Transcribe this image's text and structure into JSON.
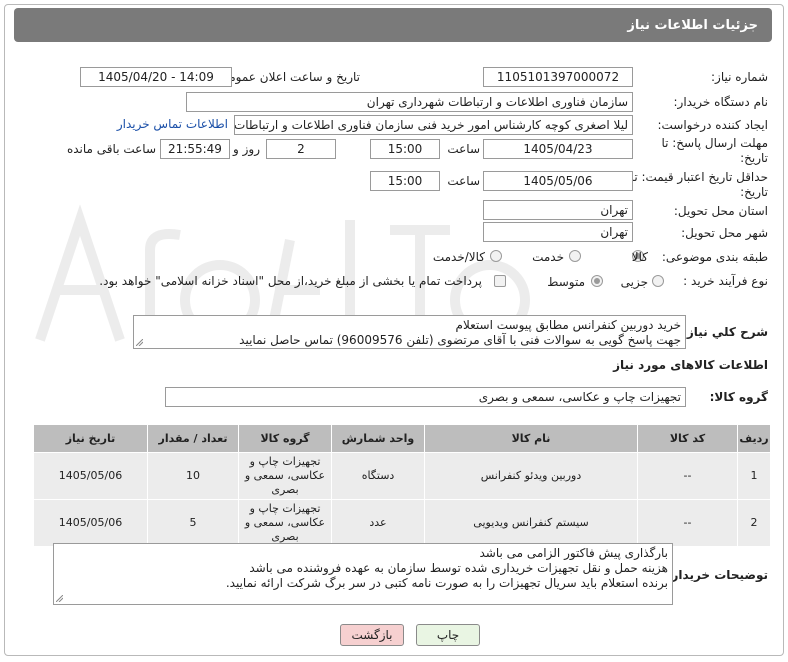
{
  "header": {
    "title": "جزئیات اطلاعات نیاز"
  },
  "fields": {
    "need_number_label": "شماره نیاز:",
    "need_number": "1105101397000072",
    "announce_label": "تاریخ و ساعت اعلان عمومی:",
    "announce_value": "1405/04/20 - 14:09",
    "buyer_org_label": "نام دستگاه خریدار:",
    "buyer_org": "سازمان فناوری اطلاعات و ارتباطات شهرداری تهران",
    "creator_label": "ایجاد کننده درخواست:",
    "creator": "لیلا اصغری کوچه کارشناس امور خرید فنی سازمان فناوری اطلاعات و ارتباطات ش",
    "contact_link": "اطلاعات تماس خریدار",
    "deadline_label": "مهلت ارسال پاسخ: تا تاریخ:",
    "deadline_date": "1405/04/23",
    "time_word": "ساعت",
    "deadline_time": "15:00",
    "days_value": "2",
    "days_label": "روز و",
    "remaining_time": "21:55:49",
    "remaining_label": "ساعت باقی مانده",
    "validity_label": "حداقل تاریخ اعتبار قیمت: تا تاریخ:",
    "validity_date": "1405/05/06",
    "validity_time": "15:00",
    "province_label": "استان محل تحویل:",
    "province": "تهران",
    "city_label": "شهر محل تحویل:",
    "city": "تهران",
    "category_label": "طبقه بندی موضوعی:",
    "category_options": [
      "کالا",
      "خدمت",
      "کالا/خدمت"
    ],
    "process_label": "نوع فرآیند خرید :",
    "process_options": [
      "جزیی",
      "متوسط"
    ],
    "payment_note": "پرداخت تمام یا بخشی از مبلغ خرید،از محل \"اسناد خزانه اسلامی\" خواهد بود."
  },
  "description": {
    "label": "شرح كلي نياز:",
    "lines": [
      "خرید دوربین کنفرانس مطابق پیوست استعلام",
      "جهت پاسخ گویی به سوالات فنی با آقای مرتضوی (تلفن 96009576) تماس حاصل نمایید"
    ]
  },
  "goods": {
    "section_title": "اطلاعات کالاهای مورد نیاز",
    "group_label": "گروه کالا:",
    "group_value": "تجهیزات چاپ و عکاسی، سمعی و بصری",
    "columns": [
      "ردیف",
      "کد کالا",
      "نام کالا",
      "واحد شمارش",
      "گروه کالا",
      "تعداد / مقدار",
      "تاریخ نیاز"
    ],
    "rows": [
      {
        "idx": "1",
        "code": "--",
        "name": "دوربین ویدئو کنفرانس",
        "unit": "دستگاه",
        "group": "تجهیزات چاپ و عکاسی، سمعی و بصری",
        "qty": "10",
        "date": "1405/05/06"
      },
      {
        "idx": "2",
        "code": "--",
        "name": "سیستم کنفرانس ویدیویی",
        "unit": "عدد",
        "group": "تجهیزات چاپ و عکاسی، سمعی و بصری",
        "qty": "5",
        "date": "1405/05/06"
      }
    ]
  },
  "buyer_notes": {
    "label": "توضیحات خریدار:",
    "lines": [
      "بارگذاری پیش فاکتور الزامی می باشد",
      "هزینه حمل و نقل تجهیزات خریداری شده توسط سازمان به عهده فروشنده می باشد",
      "برنده استعلام باید سریال تجهیزات را به صورت نامه کتبی در سر برگ شرکت ارائه نمایید."
    ]
  },
  "buttons": {
    "print": "چاپ",
    "back": "بازگشت"
  },
  "colors": {
    "header_bg": "#7a7a7a",
    "back_button_bg": "#f6d0d0",
    "print_button_bg": "#e9f5e3",
    "link": "#1a4fa8"
  }
}
